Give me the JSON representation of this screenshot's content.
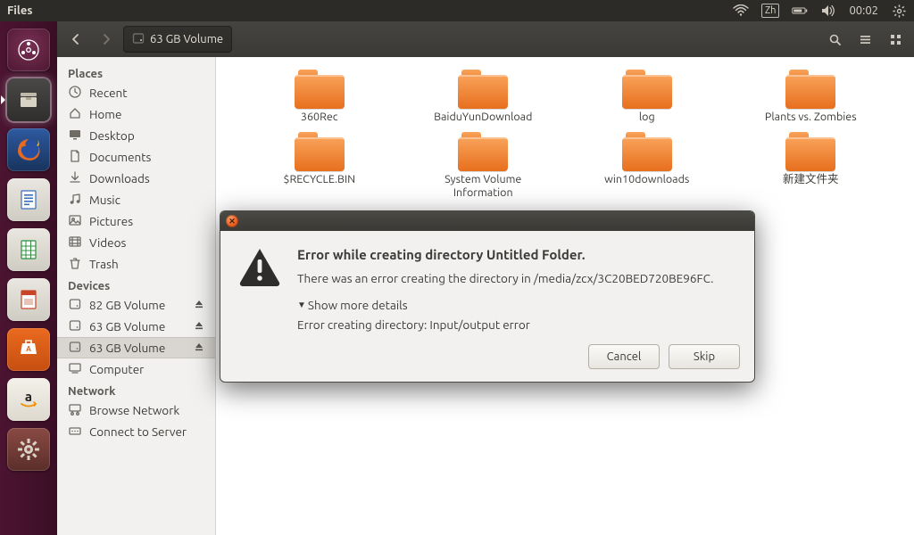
{
  "menubar": {
    "app_title": "Files",
    "input_method": "Zh",
    "clock": "00:02"
  },
  "launcher": {
    "items": [
      "dash",
      "files",
      "firefox",
      "writer",
      "calc",
      "impress",
      "software",
      "amazon",
      "settings"
    ]
  },
  "toolbar": {
    "location_label": "63 GB Volume"
  },
  "sidebar": {
    "places_heading": "Places",
    "places": [
      {
        "icon": "clock",
        "label": "Recent"
      },
      {
        "icon": "home",
        "label": "Home"
      },
      {
        "icon": "desktop",
        "label": "Desktop"
      },
      {
        "icon": "doc",
        "label": "Documents"
      },
      {
        "icon": "download",
        "label": "Downloads"
      },
      {
        "icon": "music",
        "label": "Music"
      },
      {
        "icon": "picture",
        "label": "Pictures"
      },
      {
        "icon": "video",
        "label": "Videos"
      },
      {
        "icon": "trash",
        "label": "Trash"
      }
    ],
    "devices_heading": "Devices",
    "devices": [
      {
        "icon": "hdd",
        "label": "82 GB Volume",
        "eject": true
      },
      {
        "icon": "hdd",
        "label": "63 GB Volume",
        "eject": true
      },
      {
        "icon": "hdd",
        "label": "63 GB Volume",
        "eject": true,
        "selected": true
      },
      {
        "icon": "computer",
        "label": "Computer"
      }
    ],
    "network_heading": "Network",
    "network": [
      {
        "icon": "network",
        "label": "Browse Network"
      },
      {
        "icon": "connect",
        "label": "Connect to Server"
      }
    ]
  },
  "folders": [
    "360Rec",
    "BaiduYunDownload",
    "log",
    "Plants vs. Zombies",
    "$RECYCLE.BIN",
    "System Volume Information",
    "win10downloads",
    "新建文件夹"
  ],
  "dialog": {
    "title": "Error while creating directory Untitled Folder.",
    "message": "There was an error creating the directory in /media/zcx/3C20BED720BE96FC.",
    "details_toggle": "Show more details",
    "details_text": "Error creating directory: Input/output error",
    "cancel": "Cancel",
    "skip": "Skip"
  }
}
